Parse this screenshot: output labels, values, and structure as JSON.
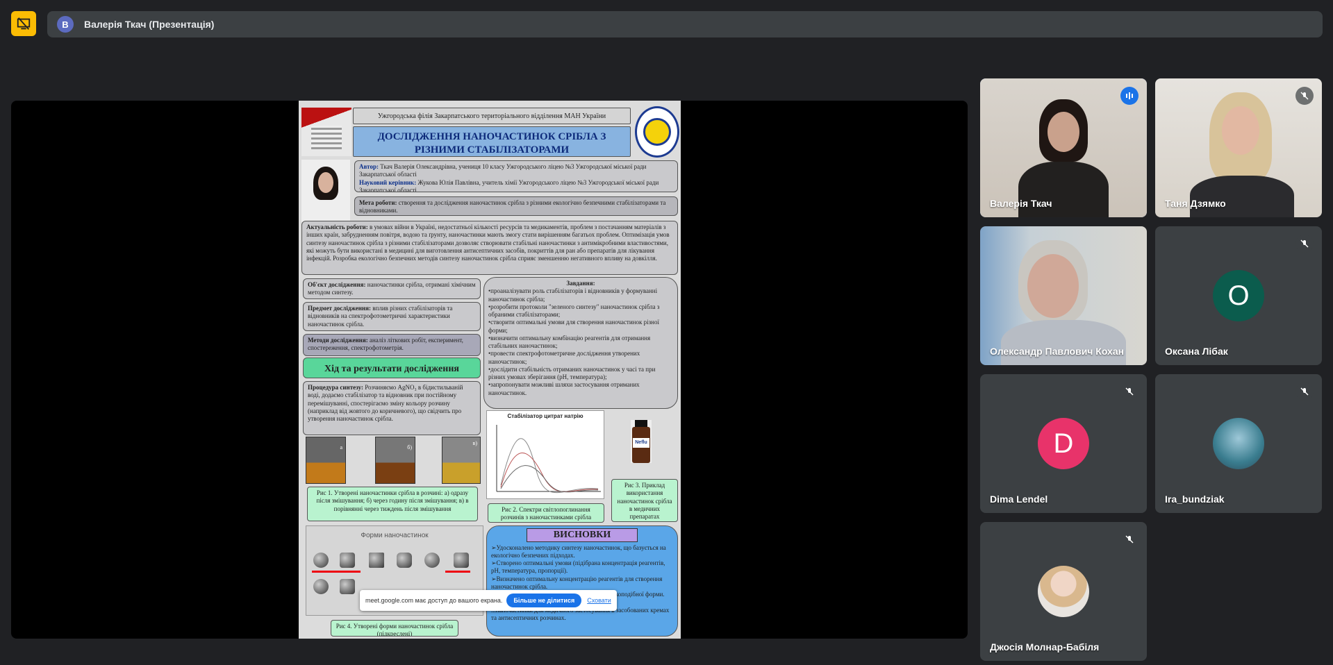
{
  "window": {
    "title": "Валерія Ткач (Презентація)",
    "avatar_letter": "В",
    "avatar_color": "#5c6bc0"
  },
  "presentation": {
    "poster": {
      "org": "Ужгородська філія Закарпатського територіального відділення МАН України",
      "title": "ДОСЛІДЖЕННЯ НАНОЧАСТИНОК СРІБЛА З РІЗНИМИ СТАБІЛІЗАТОРАМИ",
      "author_label": "Автор:",
      "author": "Ткач Валерія Олександрівна, учениця 10 класу Ужгородського ліцею №3 Ужгородської міської ради Закарпатської області",
      "advisor_label": "Науковий керівник:",
      "advisor": "Жукова Юлія Павлівна, учитель хімії Ужгородського ліцею №3 Ужгородської міської ради Закарпатської області",
      "goal_label": "Мета роботи:",
      "goal": "створення та дослідження наночастинок срібла з різними екологічно безпечними стабілізаторами та відновниками.",
      "relevance_label": "Актуальність роботи:",
      "relevance": "в умовах війни в Україні, недостатньої кількості ресурсів та медикаментів, проблем з постачанням матеріалів з інших країн, забрудненням повітря, водою та ґрунту, наночастинки мають змогу стати вирішенням багатьох проблем. Оптимізація умов синтезу наночастинок срібла з різними стабілізаторами дозволяє створювати стабільні наночастинки з антимікробними властивостями, які можуть бути використані в медицині для виготовлення антисептичних засобів, покриттів для ран або препаратів для лікування інфекцій. Розробка екологічно безпечних методів синтезу наночастинок срібла сприяє зменшенню негативного впливу на довкілля.",
      "object_label": "Об'єкт дослідження:",
      "object": "наночастинки срібла, отримані хімічним методом синтезу.",
      "subject_label": "Предмет дослідження:",
      "subject": "вплив різних стабілізаторів та відновників на спектрофотометричні характеристики наночастинок срібла.",
      "methods_label": "Методи дослідження:",
      "methods": "аналіз літкових робіт, експеримент, спостереження, спектрофотометрія.",
      "tasks_title": "Завдання:",
      "tasks": [
        "•проаналізувати роль стабілізаторів і відновників у формуванні наночастинок срібла;",
        "•розробити протоколи \"зеленого синтезу\" наночастинок срібла з обраними стабілізаторами;",
        "•створити оптимальні умови для створення наночастинок різної форми;",
        "•визначити оптимальну комбінацію реагентів для отримання стабільних наночастинок;",
        "•провести спектрофотометричне дослідження утворених наночастинок;",
        "•дослідити стабільність отриманих наночастинок у часі та при різних умовах зберігання (pH, температура);",
        "•запропонувати можливі шляхи застосування отриманих наночастинок."
      ],
      "progress_title": "Хід та результати дослідження",
      "procedure_label": "Процедура синтезу:",
      "procedure": "Розчиняємо AgNO₃ в бідистильваній воді, додаємо стабілізатор та відновник при постійному перемішуванні, спостерігаємо зміну кольору розчину (наприклад від жовтого до коричневого), що свідчить про утворення наночастинок срібла.",
      "photo_labels": [
        "а",
        "б)",
        "в)"
      ],
      "chart_title": "Стабілізатор цитрат натрію",
      "fig1": "Рис 1. Утворені наночастинки срібла в розчині: а) одразу після змішування; б) через годину після змішування; в) в порівнянні через тиждень після змішування",
      "fig2": "Рис 2. Спектри світлопоглинання розчинів з наночастинками срібла",
      "fig3": "Рис 3. Приклад використання наночастинок срібла в медичних препаратах",
      "bottle_label": "Neflu",
      "shapes_title": "Форми наночастинок",
      "fig4": "Рис 4. Утворені форми наночастинок срібла (підкреслені)",
      "conclusions_title": "ВИСНОВКИ",
      "conclusions": [
        "➢Удосконалено методику синтезу наночастинок, що базується на екологічно безпечних підходах.",
        "➢Створено оптимальні умови (підібрана концентрація реагентів, pH, температура, пропорції).",
        "➢Визначено оптимальну концентрацію реагентів для створення наночастинок срібла.",
        "➢Отримано наночастинки сферичної та паличкоподібної форми.",
        "➢ ...срібла.",
        "...наночастинки для медичного застосування в засобованих кремах та антисептичних розчинах."
      ]
    },
    "share_notice": {
      "text": "meet.google.com має доступ до вашого екрана.",
      "stop_button": "Більше не ділитися",
      "hide_link": "Сховати"
    }
  },
  "participants": [
    {
      "name": "Валерія Ткач",
      "speaking": true,
      "muted": false,
      "video": true
    },
    {
      "name": "Таня Дзямко",
      "speaking": false,
      "muted": true,
      "video": true
    },
    {
      "name": "Олександр Павлович Кохан",
      "speaking": false,
      "muted": false,
      "video": true
    },
    {
      "name": "Оксана Лібак",
      "speaking": false,
      "muted": true,
      "video": false,
      "initial": "О",
      "color": "#0b5c4d"
    },
    {
      "name": "Dima Lendel",
      "speaking": false,
      "muted": true,
      "video": false,
      "initial": "D",
      "color": "#e8336a"
    },
    {
      "name": "Ira_bundziak",
      "speaking": false,
      "muted": true,
      "video": false,
      "avatar": "photo"
    },
    {
      "name": "Джосія Молнар-Бабіля",
      "speaking": false,
      "muted": true,
      "video": false,
      "avatar": "photo"
    }
  ]
}
